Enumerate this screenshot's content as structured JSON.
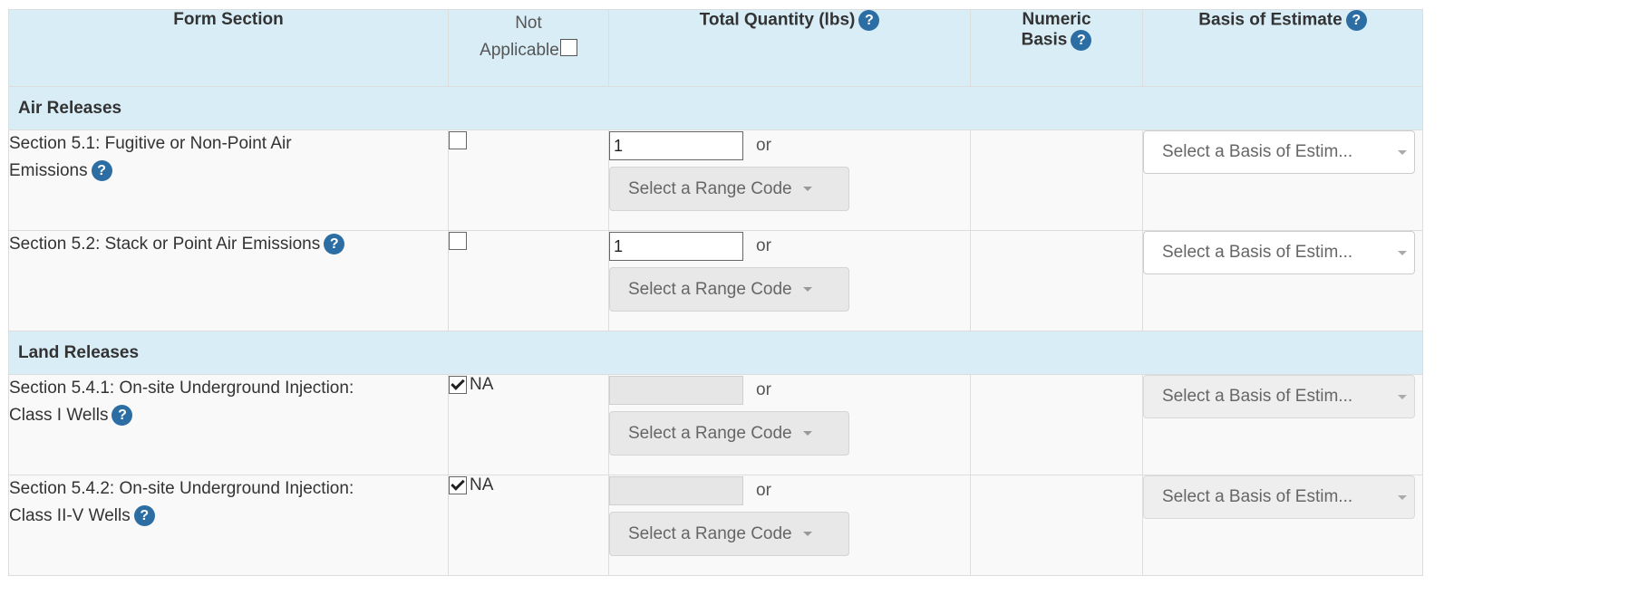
{
  "header": {
    "form_section": "Form Section",
    "not_applicable_line1": "Not",
    "not_applicable_line2": "Applicable",
    "total_quantity": "Total Quantity (lbs)",
    "numeric_line1": "Numeric",
    "numeric_line2": "Basis",
    "basis_of_estimate": "Basis of Estimate",
    "help_glyph": "?"
  },
  "groups": {
    "air": "Air Releases",
    "land": "Land Releases"
  },
  "rows": [
    {
      "label_line1": "Section 5.1: Fugitive or Non-Point Air",
      "label_line2": "Emissions",
      "na_checked": false,
      "na_text": "",
      "quantity": "1",
      "or_text": "or",
      "range_code": "Select a Range Code",
      "basis": "Select a Basis of Estim..."
    },
    {
      "label_line1": "Section 5.2: Stack or Point Air Emissions",
      "label_line2": "",
      "na_checked": false,
      "na_text": "",
      "quantity": "1",
      "or_text": "or",
      "range_code": "Select a Range Code",
      "basis": "Select a Basis of Estim..."
    },
    {
      "label_line1": "Section 5.4.1: On-site Underground Injection:",
      "label_line2": "Class I Wells",
      "na_checked": true,
      "na_text": "NA",
      "quantity": "",
      "or_text": "or",
      "range_code": "Select a Range Code",
      "basis": "Select a Basis of Estim..."
    },
    {
      "label_line1": "Section 5.4.2: On-site Underground Injection:",
      "label_line2": "Class II-V Wells",
      "na_checked": true,
      "na_text": "NA",
      "quantity": "",
      "or_text": "or",
      "range_code": "Select a Range Code",
      "basis": "Select a Basis of Estim..."
    }
  ],
  "colors": {
    "header_bg": "#d9edf7",
    "help_icon": "#2c6da3",
    "row_bg": "#f9f9f9"
  }
}
